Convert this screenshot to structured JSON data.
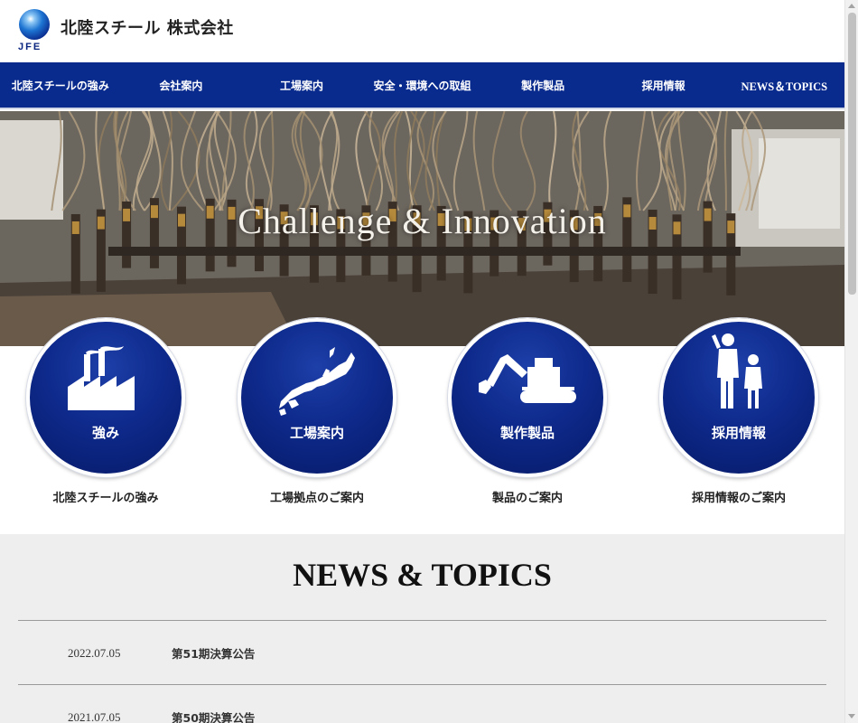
{
  "header": {
    "logo_text": "JFE",
    "company_name": "北陸スチール 株式会社"
  },
  "nav": {
    "items": [
      {
        "label": "北陸スチールの強み"
      },
      {
        "label": "会社案内"
      },
      {
        "label": "工場案内"
      },
      {
        "label": "安全・環境への取組"
      },
      {
        "label": "製作製品"
      },
      {
        "label": "採用情報"
      },
      {
        "label": "NEWS＆TOPICS"
      }
    ]
  },
  "hero": {
    "tagline": "Challenge & Innovation"
  },
  "features": [
    {
      "label": "強み",
      "caption": "北陸スチールの強み",
      "icon": "factory-icon"
    },
    {
      "label": "工場案内",
      "caption": "工場拠点のご案内",
      "icon": "japan-map-icon"
    },
    {
      "label": "製作製品",
      "caption": "製品のご案内",
      "icon": "excavator-icon"
    },
    {
      "label": "採用情報",
      "caption": "採用情報のご案内",
      "icon": "people-icon"
    }
  ],
  "news": {
    "title": "NEWS & TOPICS",
    "items": [
      {
        "date": "2022.07.05",
        "text": "第51期決算公告"
      },
      {
        "date": "2021.07.05",
        "text": "第50期決算公告"
      }
    ]
  },
  "colors": {
    "nav_bg": "#0a2b8e",
    "circle_bg": "#0e2a8c",
    "news_bg": "#eeeeee"
  }
}
